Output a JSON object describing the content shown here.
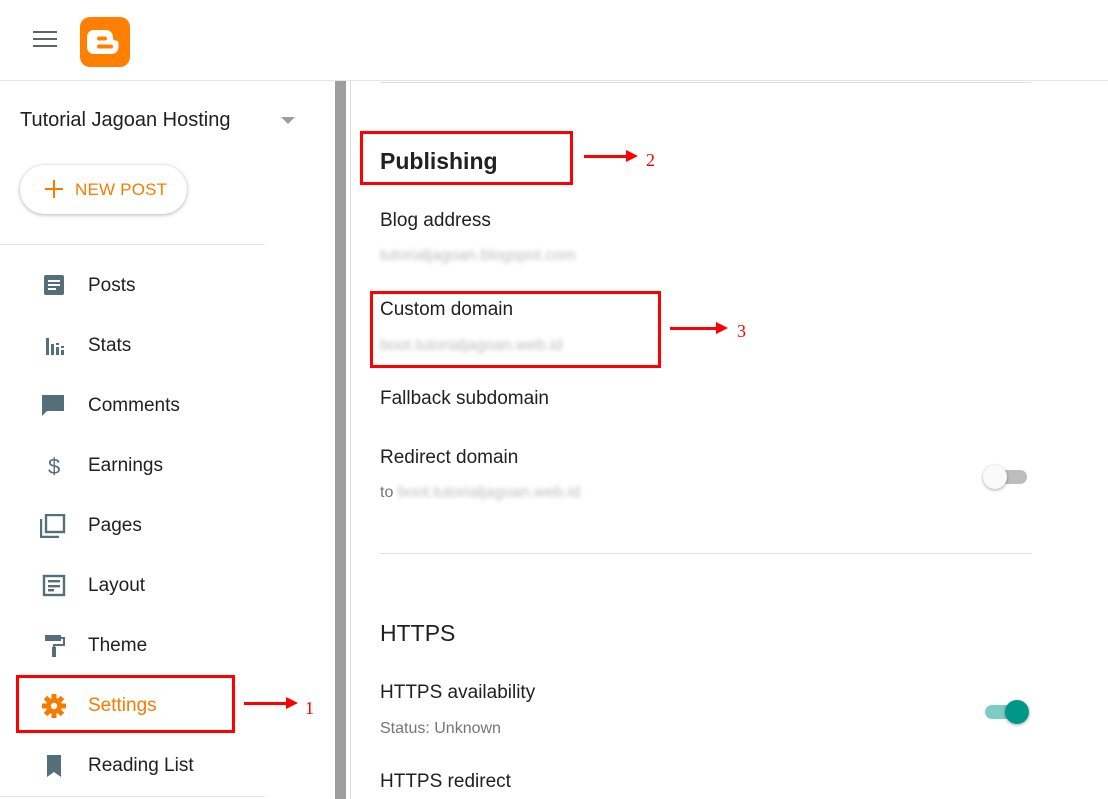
{
  "app": {
    "logo": "blogger-logo",
    "menu_icon": "hamburger-icon"
  },
  "sidebar": {
    "blog_name": "Tutorial Jagoan Hosting",
    "new_post_label": "NEW POST",
    "items": [
      {
        "label": "Posts",
        "icon": "posts-icon"
      },
      {
        "label": "Stats",
        "icon": "stats-icon"
      },
      {
        "label": "Comments",
        "icon": "comments-icon"
      },
      {
        "label": "Earnings",
        "icon": "dollar-icon"
      },
      {
        "label": "Pages",
        "icon": "pages-icon"
      },
      {
        "label": "Layout",
        "icon": "layout-icon"
      },
      {
        "label": "Theme",
        "icon": "paint-roller-icon"
      },
      {
        "label": "Settings",
        "icon": "gear-icon",
        "active": true
      },
      {
        "label": "Reading List",
        "icon": "bookmark-icon"
      }
    ]
  },
  "publishing": {
    "title": "Publishing",
    "blog_address_label": "Blog address",
    "blog_address_value": "tutorialjagoan.blogspot.com",
    "custom_domain_label": "Custom domain",
    "custom_domain_value": "boot.tutorialjagoan.web.id",
    "fallback_label": "Fallback subdomain",
    "redirect_label": "Redirect domain",
    "redirect_prefix": "to",
    "redirect_value": "boot.tutorialjagoan.web.id",
    "redirect_enabled": false
  },
  "https": {
    "title": "HTTPS",
    "availability_label": "HTTPS availability",
    "availability_status": "Status: Unknown",
    "availability_enabled": true,
    "redirect_label": "HTTPS redirect"
  },
  "annotations": {
    "one": "1",
    "two": "2",
    "three": "3"
  },
  "colors": {
    "accent": "#f57c00",
    "logo": "#ff8000",
    "toggle_on": "#009688",
    "annotation": "#ff0000"
  }
}
